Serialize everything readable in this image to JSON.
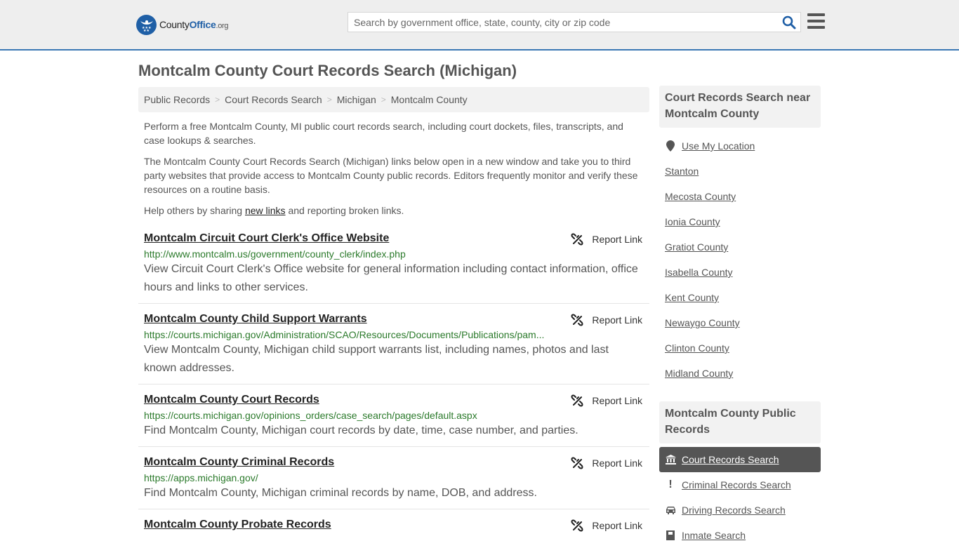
{
  "header": {
    "logo_part1": "County",
    "logo_part2": "Office",
    "logo_part3": ".org",
    "search_placeholder": "Search by government office, state, county, city or zip code",
    "search_icon": "search-icon",
    "menu_icon": "hamburger-menu-icon"
  },
  "page": {
    "title": "Montcalm County Court Records Search (Michigan)"
  },
  "breadcrumb": [
    {
      "label": "Public Records"
    },
    {
      "label": "Court Records Search"
    },
    {
      "label": "Michigan"
    },
    {
      "label": "Montcalm County"
    }
  ],
  "intro": {
    "p1": "Perform a free Montcalm County, MI public court records search, including court dockets, files, transcripts, and case lookups & searches.",
    "p2": "The Montcalm County Court Records Search (Michigan) links below open in a new window and take you to third party websites that provide access to Montcalm County public records. Editors frequently monitor and verify these resources on a routine basis.",
    "p3_before": "Help others by sharing ",
    "p3_link": "new links",
    "p3_after": " and reporting broken links."
  },
  "results": [
    {
      "title": "Montcalm Circuit Court Clerk's Office Website",
      "url": "http://www.montcalm.us/government/county_clerk/index.php",
      "description": "View Circuit Court Clerk's Office website for general information including contact information, office hours and links to other services.",
      "report_label": "Report Link"
    },
    {
      "title": "Montcalm County Child Support Warrants",
      "url": "https://courts.michigan.gov/Administration/SCAO/Resources/Documents/Publications/pam...",
      "description": "View Montcalm County, Michigan child support warrants list, including names, photos and last known addresses.",
      "report_label": "Report Link"
    },
    {
      "title": "Montcalm County Court Records",
      "url": "https://courts.michigan.gov/opinions_orders/case_search/pages/default.aspx",
      "description": "Find Montcalm County, Michigan court records by date, time, case number, and parties.",
      "report_label": "Report Link"
    },
    {
      "title": "Montcalm County Criminal Records",
      "url": "https://apps.michigan.gov/",
      "description": "Find Montcalm County, Michigan criminal records by name, DOB, and address.",
      "report_label": "Report Link"
    },
    {
      "title": "Montcalm County Probate Records",
      "url": "",
      "description": "",
      "report_label": "Report Link"
    }
  ],
  "sidebar": {
    "nearby": {
      "heading": "Court Records Search near Montcalm County",
      "use_location": "Use My Location",
      "items": [
        "Stanton",
        "Mecosta County",
        "Ionia County",
        "Gratiot County",
        "Isabella County",
        "Kent County",
        "Newaygo County",
        "Clinton County",
        "Midland County"
      ]
    },
    "public_records": {
      "heading": "Montcalm County Public Records",
      "items": [
        {
          "label": "Court Records Search",
          "icon": "courthouse-icon",
          "active": true
        },
        {
          "label": "Criminal Records Search",
          "icon": "exclamation-icon",
          "active": false
        },
        {
          "label": "Driving Records Search",
          "icon": "car-icon",
          "active": false
        },
        {
          "label": "Inmate Search",
          "icon": "inmate-icon",
          "active": false
        }
      ]
    }
  }
}
